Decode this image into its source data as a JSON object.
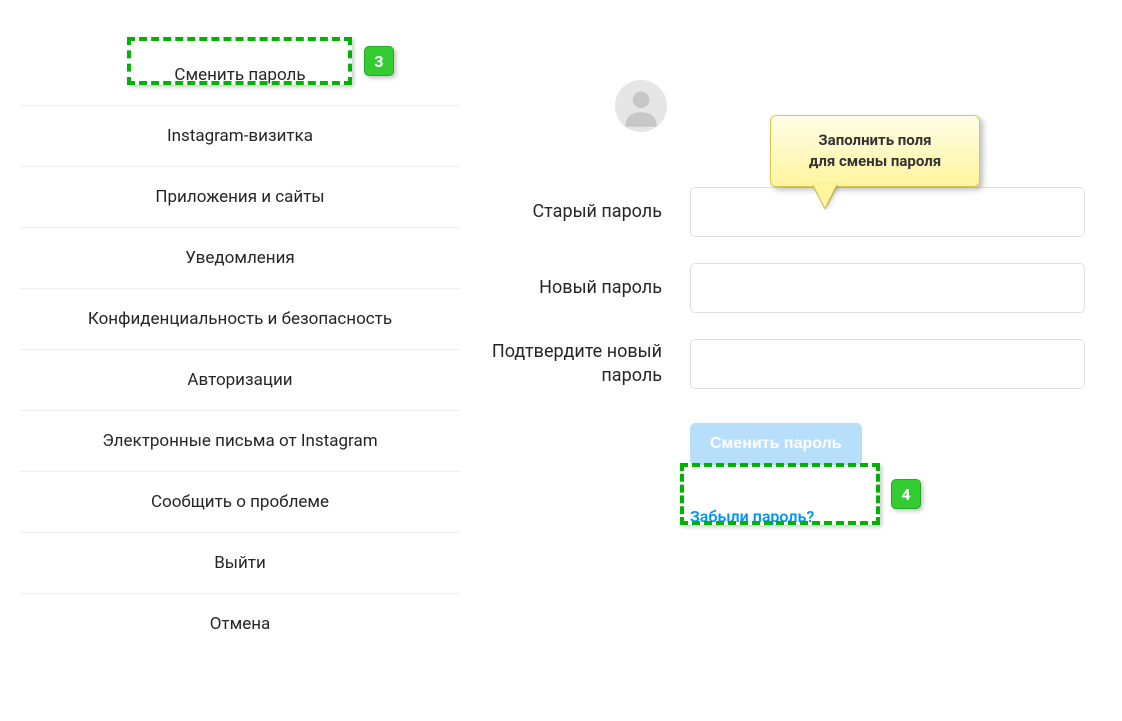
{
  "sidebar": {
    "items": [
      {
        "label": "Сменить пароль"
      },
      {
        "label": "Instagram-визитка"
      },
      {
        "label": "Приложения и сайты"
      },
      {
        "label": "Уведомления"
      },
      {
        "label": "Конфиденциальность и безопасность"
      },
      {
        "label": "Авторизации"
      },
      {
        "label": "Электронные письма от Instagram"
      },
      {
        "label": "Сообщить о проблеме"
      },
      {
        "label": "Выйти"
      },
      {
        "label": "Отмена"
      }
    ]
  },
  "form": {
    "old_password_label": "Старый пароль",
    "new_password_label": "Новый пароль",
    "confirm_password_label": "Подтвердите новый пароль",
    "submit_label": "Сменить пароль",
    "forgot_label": "Забыли пароль?"
  },
  "annotations": {
    "step3": "3",
    "step4": "4",
    "tooltip_line1": "Заполнить поля",
    "tooltip_line2": "для смены пароля"
  }
}
